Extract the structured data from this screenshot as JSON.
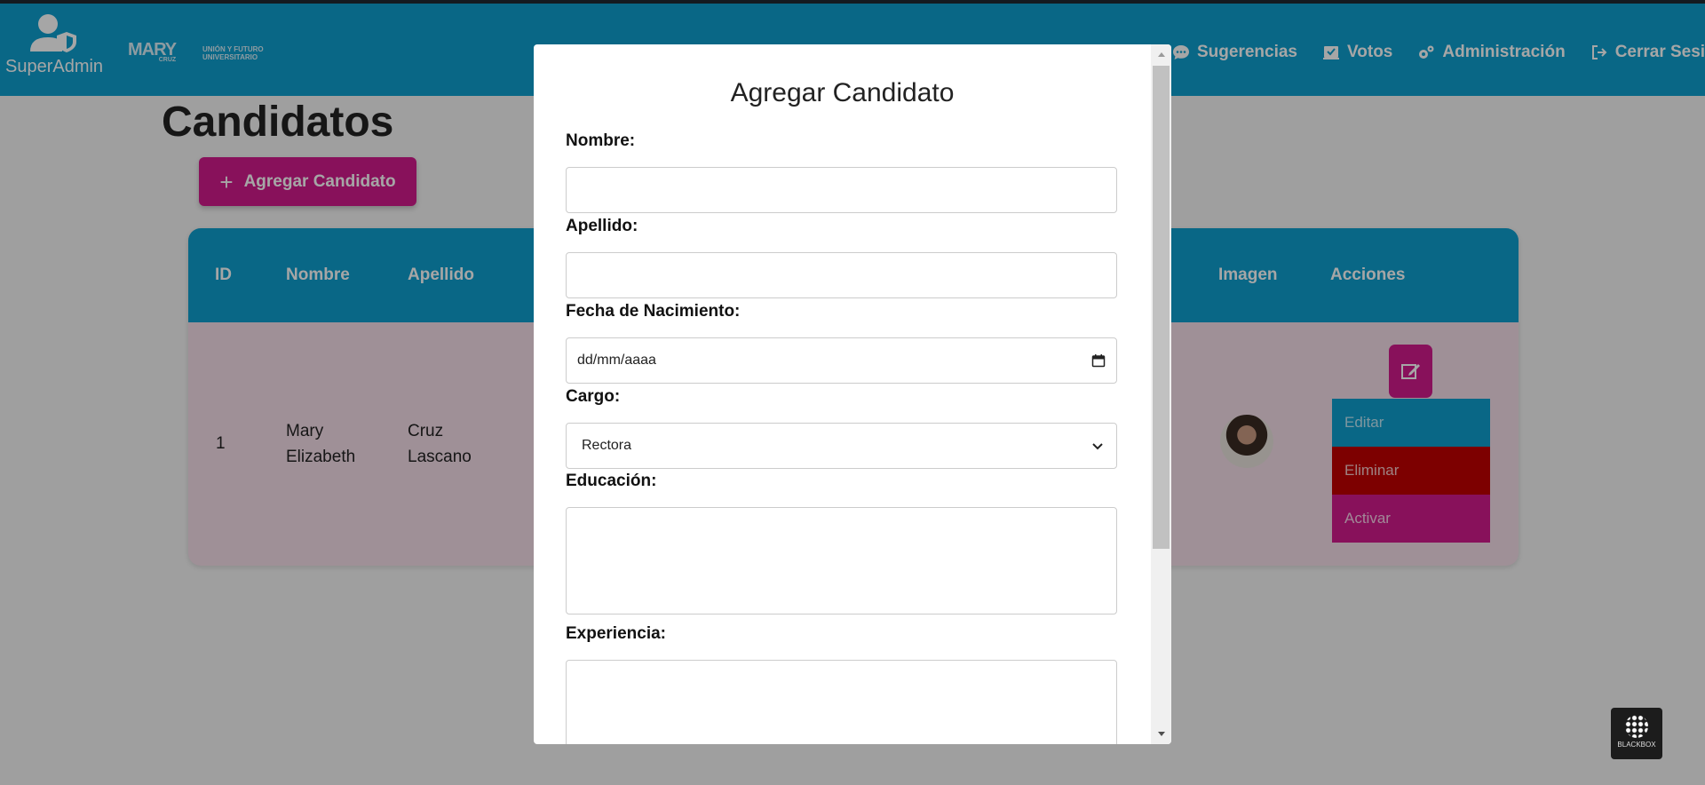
{
  "brand": {
    "label": "SuperAdmin",
    "logo_text": "MARY",
    "logo_sub": "CRUZ",
    "logo_union_line1": "UNIÓN Y FUTURO",
    "logo_union_line2": "UNIVERSITARIO"
  },
  "nav": [
    {
      "label": "Sugerencias",
      "icon": "chat-bubble-icon"
    },
    {
      "label": "Votos",
      "icon": "ballot-icon"
    },
    {
      "label": "Administración",
      "icon": "gears-icon"
    },
    {
      "label": "Cerrar Sesión",
      "icon": "sign-out-icon"
    }
  ],
  "page": {
    "title": "Candidatos",
    "add_button": "Agregar Candidato"
  },
  "table": {
    "headers": {
      "id": "ID",
      "nombre": "Nombre",
      "apellido": "Apellido",
      "imagen": "Imagen",
      "acciones": "Acciones"
    },
    "rows": [
      {
        "id": "1",
        "nombre_1": "Mary",
        "nombre_2": "Elizabeth",
        "apellido_1": "Cruz",
        "apellido_2": "Lascano"
      }
    ],
    "actions_menu": {
      "editar": "Editar",
      "eliminar": "Eliminar",
      "activar": "Activar"
    }
  },
  "colors": {
    "primary": "#0f9fce",
    "accent": "#d21b8c",
    "danger": "#c00000",
    "row_bg": "#f5dde9"
  },
  "modal": {
    "title": "Agregar Candidato",
    "fields": {
      "nombre": {
        "label": "Nombre:",
        "value": ""
      },
      "apellido": {
        "label": "Apellido:",
        "value": ""
      },
      "fecha": {
        "label": "Fecha de Nacimiento:",
        "placeholder": "dd/mm/aaaa"
      },
      "cargo": {
        "label": "Cargo:",
        "selected": "Rectora"
      },
      "educacion": {
        "label": "Educación:",
        "value": ""
      },
      "experiencia": {
        "label": "Experiencia:",
        "value": ""
      }
    }
  },
  "badge": {
    "label": "BLACKBOX"
  }
}
